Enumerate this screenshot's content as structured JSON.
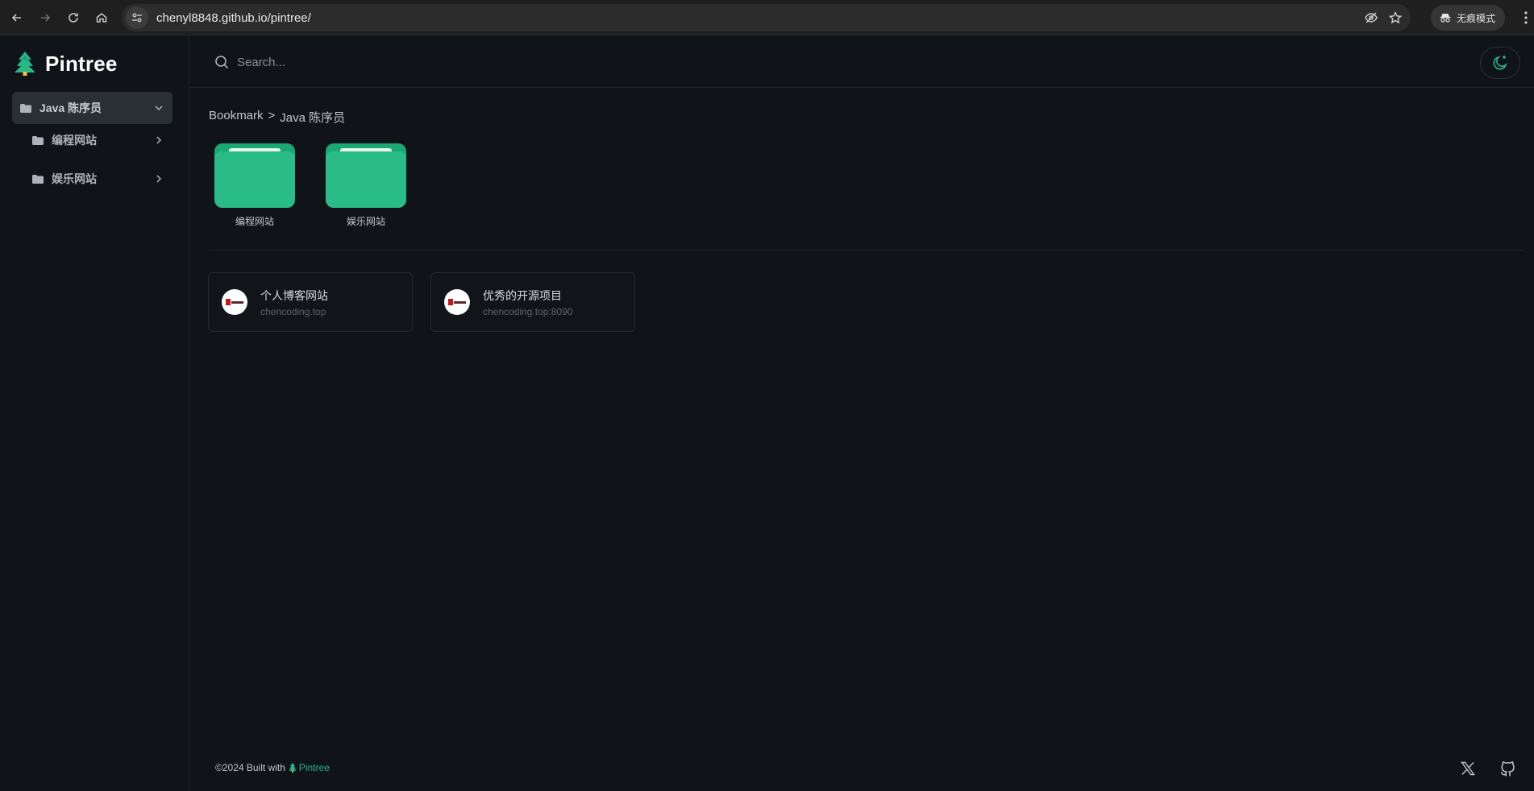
{
  "browser": {
    "url_host": "chenyl8848.github.io",
    "url_path": "/pintree/",
    "incognito_label": "无痕模式"
  },
  "brand": {
    "name": "Pintree",
    "accent": "#26b885"
  },
  "sidebar": {
    "items": [
      {
        "label": "Java 陈序员",
        "icon": "folder-icon",
        "expanded": true
      },
      {
        "label": "编程网站",
        "icon": "folder-icon"
      },
      {
        "label": "娱乐网站",
        "icon": "folder-icon"
      }
    ]
  },
  "search": {
    "placeholder": "Search..."
  },
  "breadcrumb": {
    "root": "Bookmark",
    "separator": ">",
    "current": "Java 陈序员"
  },
  "folders": [
    {
      "label": "编程网站"
    },
    {
      "label": "娱乐网站"
    }
  ],
  "bookmarks": [
    {
      "title": "个人博客网站",
      "url": "chencoding.top"
    },
    {
      "title": "优秀的开源项目",
      "url": "chencoding.top:8090"
    }
  ],
  "footer": {
    "prefix": "©2024 Built with",
    "brand": "Pintree"
  }
}
